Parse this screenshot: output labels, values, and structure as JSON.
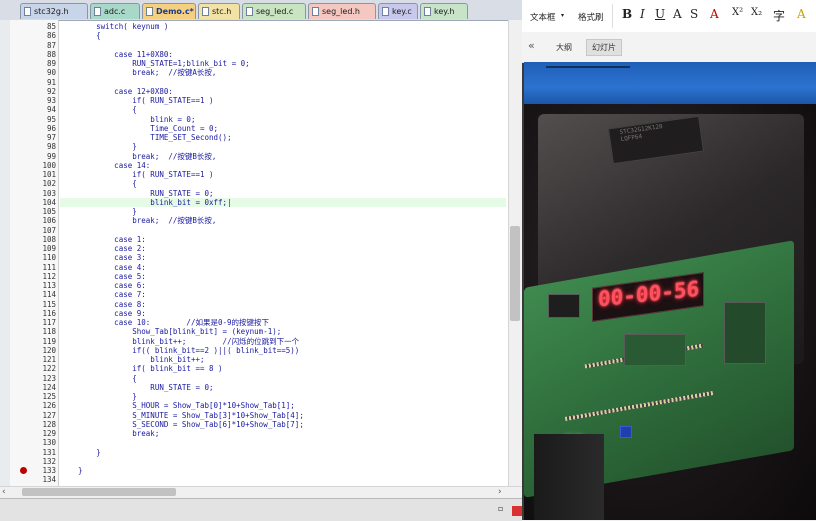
{
  "editor": {
    "tabs": [
      {
        "label": "stc32g.h",
        "color": "#c8d4e8",
        "active": false
      },
      {
        "label": "adc.c",
        "color": "#a8d8c8",
        "active": false
      },
      {
        "label": "Demo.c*",
        "color": "#f5d080",
        "active": true
      },
      {
        "label": "stc.h",
        "color": "#f3e2a6",
        "active": false
      },
      {
        "label": "seg_led.c",
        "color": "#c8e4c0",
        "active": false
      },
      {
        "label": "seg_led.h",
        "color": "#f4c8c0",
        "active": false
      },
      {
        "label": "key.c",
        "color": "#c8c8ec",
        "active": false
      },
      {
        "label": "key.h",
        "color": "#c8e4c8",
        "active": false
      }
    ],
    "tab_controls": "▼ ✕",
    "highlight_line": "104",
    "breakpoint_line": "133",
    "lines": [
      {
        "n": "85",
        "code": "        switch( keynum )"
      },
      {
        "n": "86",
        "code": "        {"
      },
      {
        "n": "87",
        "code": ""
      },
      {
        "n": "88",
        "code": "            case 11+0X80:"
      },
      {
        "n": "89",
        "code": "                RUN_STATE=1;blink_bit = 0;"
      },
      {
        "n": "90",
        "code": "                break;  //按键A长按,"
      },
      {
        "n": "91",
        "code": ""
      },
      {
        "n": "92",
        "code": "            case 12+0X80:"
      },
      {
        "n": "93",
        "code": "                if( RUN_STATE==1 )"
      },
      {
        "n": "94",
        "code": "                {"
      },
      {
        "n": "95",
        "code": "                    blink = 0;"
      },
      {
        "n": "96",
        "code": "                    Time_Count = 0;"
      },
      {
        "n": "97",
        "code": "                    TIME_SET_Second();"
      },
      {
        "n": "98",
        "code": "                }"
      },
      {
        "n": "99",
        "code": "                break;  //按键B长按,"
      },
      {
        "n": "100",
        "code": "            case 14:"
      },
      {
        "n": "101",
        "code": "                if( RUN_STATE==1 )"
      },
      {
        "n": "102",
        "code": "                {"
      },
      {
        "n": "103",
        "code": "                    RUN_STATE = 0;"
      },
      {
        "n": "104",
        "code": "                    blink_bit = 0xff;|"
      },
      {
        "n": "105",
        "code": "                }"
      },
      {
        "n": "106",
        "code": "                break;  //按键B长按,"
      },
      {
        "n": "107",
        "code": ""
      },
      {
        "n": "108",
        "code": "            case 1:"
      },
      {
        "n": "109",
        "code": "            case 2:"
      },
      {
        "n": "110",
        "code": "            case 3:"
      },
      {
        "n": "111",
        "code": "            case 4:"
      },
      {
        "n": "112",
        "code": "            case 5:"
      },
      {
        "n": "113",
        "code": "            case 6:"
      },
      {
        "n": "114",
        "code": "            case 7:"
      },
      {
        "n": "115",
        "code": "            case 8:"
      },
      {
        "n": "116",
        "code": "            case 9:"
      },
      {
        "n": "117",
        "code": "            case 10:        //如果是0-9的按键按下"
      },
      {
        "n": "118",
        "code": "                Show_Tab[blink_bit] = (keynum-1);"
      },
      {
        "n": "119",
        "code": "                blink_bit++;        //闪烁的位跳到下一个"
      },
      {
        "n": "120",
        "code": "                if(( blink_bit==2 )||( blink_bit==5))"
      },
      {
        "n": "121",
        "code": "                    blink_bit++;"
      },
      {
        "n": "122",
        "code": "                if( blink_bit == 8 )"
      },
      {
        "n": "123",
        "code": "                {"
      },
      {
        "n": "124",
        "code": "                    RUN_STATE = 0;"
      },
      {
        "n": "125",
        "code": "                }"
      },
      {
        "n": "126",
        "code": "                S_HOUR = Show_Tab[0]*10+Show_Tab[1];"
      },
      {
        "n": "127",
        "code": "                S_MINUTE = Show_Tab[3]*10+Show_Tab[4];"
      },
      {
        "n": "128",
        "code": "                S_SECOND = Show_Tab[6]*10+Show_Tab[7];"
      },
      {
        "n": "129",
        "code": "                break;"
      },
      {
        "n": "130",
        "code": ""
      },
      {
        "n": "131",
        "code": "        }"
      },
      {
        "n": "132",
        "code": ""
      },
      {
        "n": "133",
        "code": "    }"
      },
      {
        "n": "134",
        "code": ""
      }
    ],
    "scroll_left": "‹",
    "scroll_right": "›",
    "status_pin": "📌",
    "status_close": "✕"
  },
  "ppt": {
    "ribbon": {
      "textbox_label": "文本框",
      "format_painter_label": "格式刷",
      "format_buttons": [
        "B",
        "I",
        "U",
        "A",
        "S",
        "A",
        "X²",
        "X₂",
        "字",
        "A"
      ]
    },
    "panel": {
      "collapse": "«",
      "tab_outline": "大纲",
      "tab_slides": "幻灯片"
    },
    "photo": {
      "display_text": "00-00-56",
      "chip_text": "STC32G12K128\nLQFP64\n"
    }
  },
  "colors": {
    "code_text": "#1a1aa0",
    "highlight": "#e6fbe6",
    "breakpoint": "#c00000",
    "ppt_blue": "#2b73d0",
    "seg_led": "#ff5060"
  }
}
